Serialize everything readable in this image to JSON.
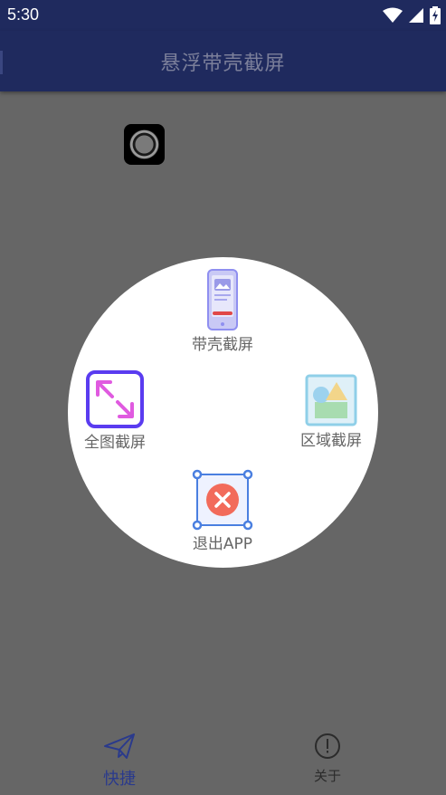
{
  "status_bar": {
    "time": "5:30"
  },
  "app_bar": {
    "title": "悬浮带壳截屏"
  },
  "menu": {
    "items": [
      {
        "label": "带壳截屏",
        "icon": "phone-frame-icon"
      },
      {
        "label": "全图截屏",
        "icon": "expand-arrows-icon"
      },
      {
        "label": "区域截屏",
        "icon": "shapes-region-icon"
      },
      {
        "label": "退出APP",
        "icon": "close-circle-icon"
      }
    ]
  },
  "bottom_nav": {
    "tabs": [
      {
        "label": "快捷",
        "icon": "paper-plane-icon",
        "active": true
      },
      {
        "label": "关于",
        "icon": "info-circle-icon",
        "active": false
      }
    ]
  },
  "colors": {
    "header": "#1f2a5e",
    "overlay": "#666666",
    "active_tab": "#2a3a8c",
    "inactive_tab": "#2b2b2b",
    "label_gray": "#666666"
  }
}
